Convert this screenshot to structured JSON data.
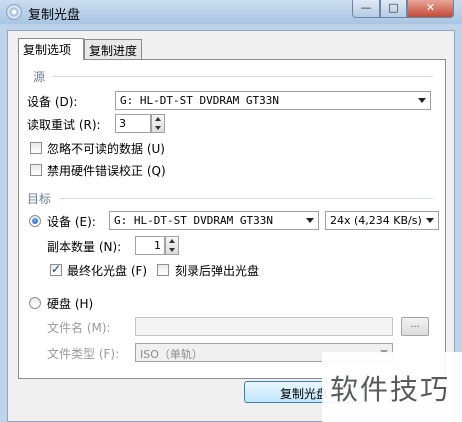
{
  "window": {
    "title": "复制光盘",
    "controls": {
      "minimize": "—",
      "maximize": "□",
      "close": "✕"
    }
  },
  "tabs": [
    {
      "label": "复制选项",
      "active": true
    },
    {
      "label": "复制进度",
      "active": false
    }
  ],
  "source": {
    "group_label": "源",
    "device_label": "设备 (D):",
    "device_value": "G: HL-DT-ST DVDRAM GT33N",
    "retry_label": "读取重试 (R):",
    "retry_value": "3",
    "ignore_unreadable_label": "忽略不可读的数据 (U)",
    "ignore_unreadable_checked": false,
    "disable_hw_ecc_label": "禁用硬件错误校正 (Q)",
    "disable_hw_ecc_checked": false
  },
  "target": {
    "group_label": "目标",
    "device_radio_label": "设备 (E):",
    "device_radio_selected": true,
    "device_value": "G: HL-DT-ST DVDRAM GT33N",
    "speed_value": "24x (4,234 KB/s)",
    "copies_label": "副本数量 (N):",
    "copies_value": "1",
    "finalize_label": "最终化光盘 (F)",
    "finalize_checked": true,
    "eject_label": "刻录后弹出光盘",
    "eject_checked": false,
    "harddisk_radio_label": "硬盘 (H)",
    "harddisk_radio_selected": false,
    "filename_label": "文件名 (M):",
    "filename_value": "",
    "browse_label": "...",
    "filetype_label": "文件类型 (F):",
    "filetype_value": "ISO（单轨）"
  },
  "footer": {
    "copy_button_label": "复制光盘"
  },
  "watermark": {
    "text": "软件技巧"
  }
}
